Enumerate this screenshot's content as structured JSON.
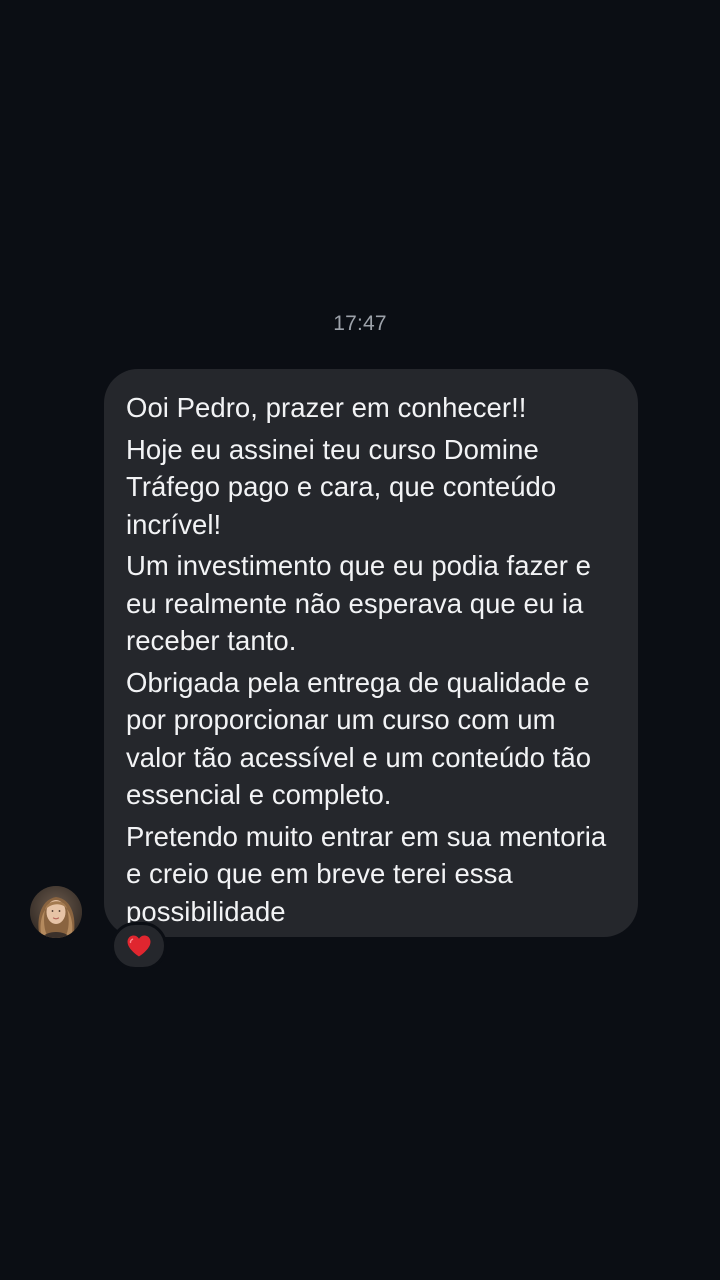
{
  "chat": {
    "timestamp": "17:47",
    "message": {
      "paragraphs": [
        "Ooi Pedro, prazer em conhecer!!",
        "Hoje eu assinei teu curso Domine Tráfego pago e cara, que conteúdo incrível!",
        "Um investimento que eu podia fazer e eu realmente não esperava que eu ia receber tanto.",
        "Obrigada pela entrega de qualidade e por proporcionar um curso com um valor tão acessível e um conteúdo tão essencial e completo.",
        "Pretendo muito entrar em sua mentoria e creio que em breve terei essa possibilidade"
      ],
      "reaction_icon": "heart-icon"
    },
    "colors": {
      "background": "#0b0e14",
      "bubble": "#25272c",
      "text": "#f2f3f5",
      "timestamp": "#9da2aa",
      "reaction_heart": "#e0262f"
    }
  }
}
